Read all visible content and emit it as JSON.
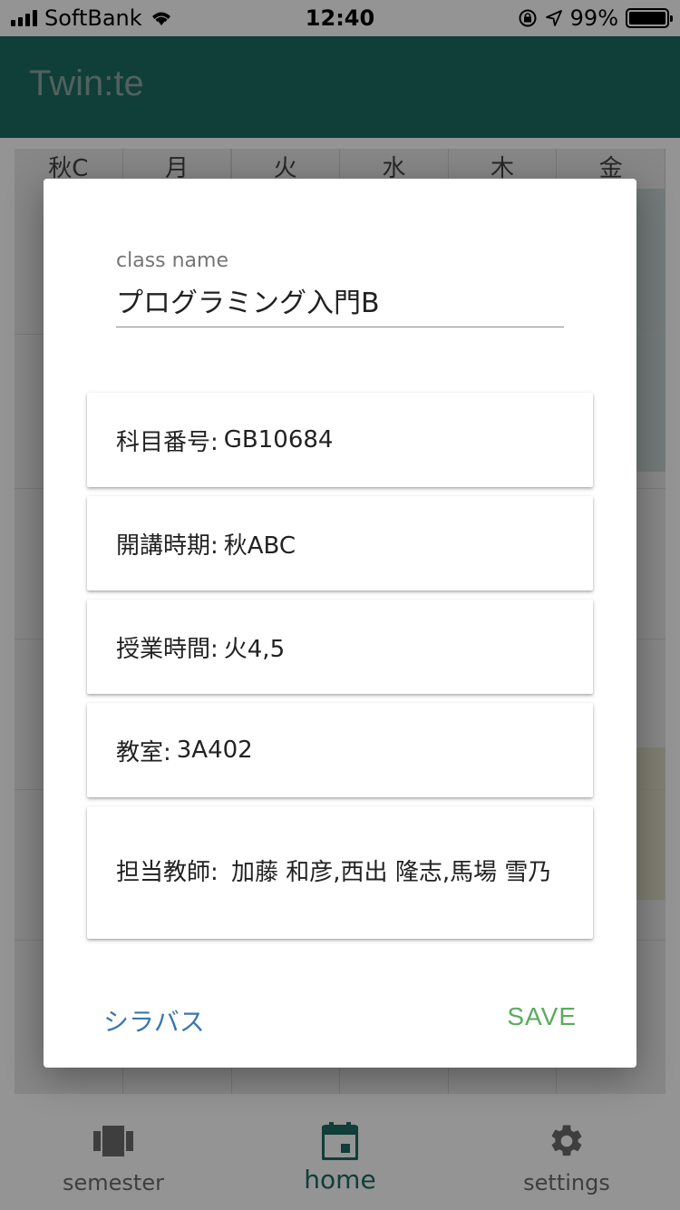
{
  "status_bar": {
    "carrier": "SoftBank",
    "time": "12:40",
    "battery": "99%",
    "battery_level": 0.99
  },
  "app_bar": {
    "title": "Twin:te"
  },
  "timetable": {
    "headers": [
      "秋C",
      "月",
      "火",
      "水",
      "木",
      "金"
    ]
  },
  "dialog": {
    "class_name_label": "class name",
    "class_name_value": "プログラミング入門B",
    "cards": {
      "course_number_label": "科目番号:",
      "course_number_value": "GB10684",
      "term_label": "開講時期:",
      "term_value": "秋ABC",
      "time_label": "授業時間:",
      "time_value": "火4,5",
      "room_label": "教室:",
      "room_value": "3A402",
      "instructor_label": "担当教師:",
      "instructor_value": "加藤 和彦,西出 隆志,馬場 雪乃"
    },
    "syllabus_button": "シラバス",
    "save_button": "SAVE"
  },
  "bottom_nav": {
    "items": [
      {
        "label": "semester",
        "icon": "semester-icon"
      },
      {
        "label": "home",
        "icon": "calendar-icon"
      },
      {
        "label": "settings",
        "icon": "gear-icon"
      }
    ],
    "active": "home"
  },
  "colors": {
    "primary": "#1d6b62",
    "save": "#5aab5e",
    "syllabus": "#3b76b0"
  }
}
